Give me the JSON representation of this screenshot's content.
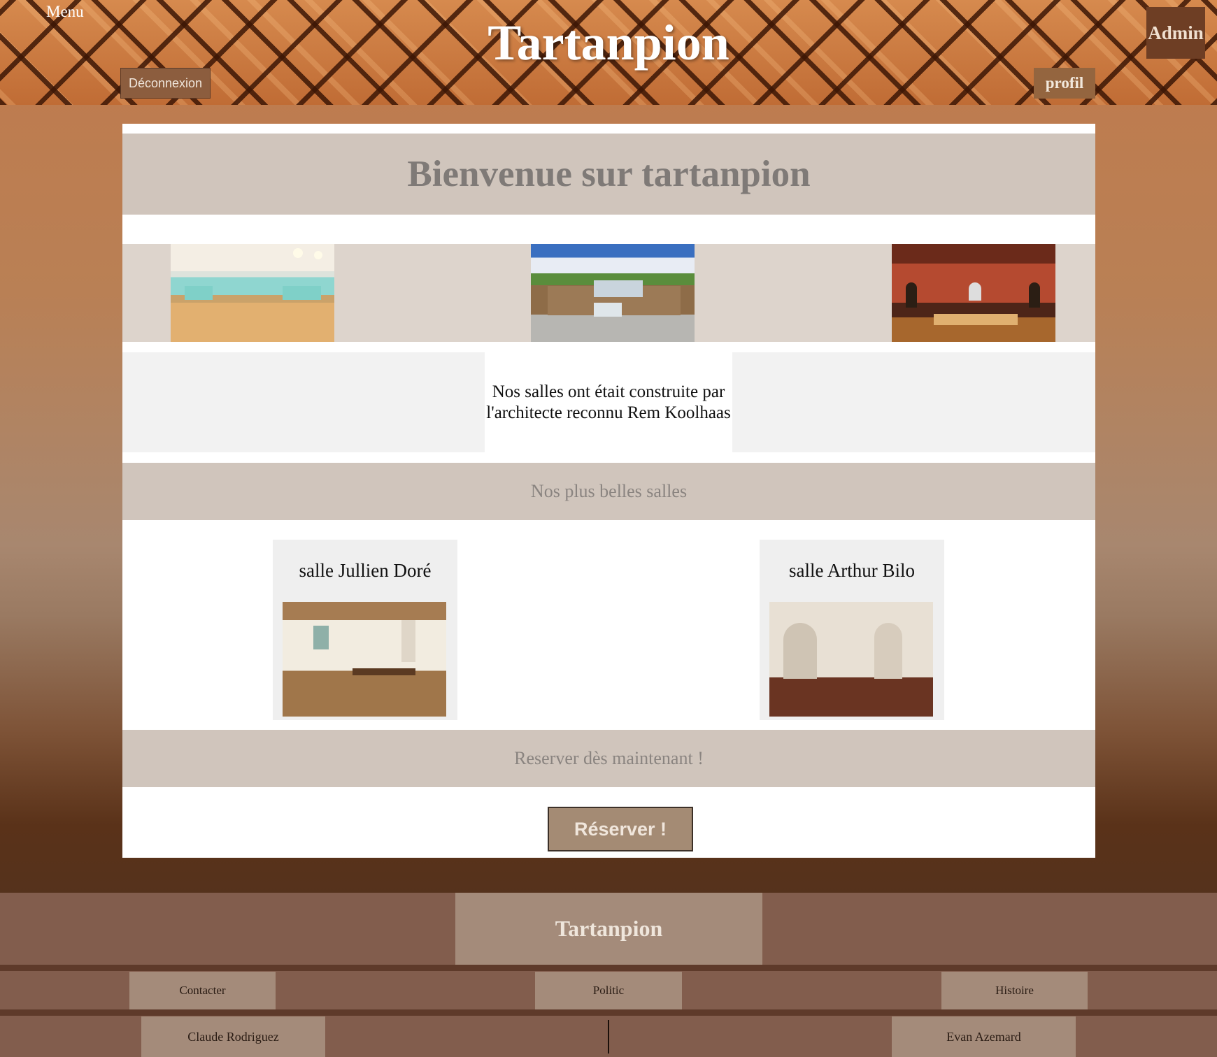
{
  "header": {
    "menu_label": "Menu",
    "site_title": "Tartanpion",
    "logout_label": "Déconnexion",
    "admin_label": "Admin",
    "profil_label": "profil"
  },
  "main": {
    "welcome_title": "Bienvenue sur tartanpion",
    "info_text": "Nos salles ont était construite par l'architecte reconnu Rem Koolhaas",
    "section_salles_title": "Nos plus belles salles",
    "rooms": [
      {
        "name": "salle Jullien Doré"
      },
      {
        "name": "salle Arthur Bilo"
      }
    ],
    "section_reserve_title": "Reserver dès maintenant !",
    "reserve_button_label": "Réserver !"
  },
  "footer": {
    "title": "Tartanpion",
    "links": [
      {
        "label": "Contacter"
      },
      {
        "label": "Politic"
      },
      {
        "label": "Histoire"
      }
    ],
    "authors": [
      {
        "name": "Claude Rodriguez"
      },
      {
        "name": "Evan Azemard"
      }
    ]
  },
  "colors": {
    "header_wood": "#c8773f",
    "band_beige": "#d0c5bc",
    "button_taupe": "#a48b74",
    "footer_brown": "#825d4d"
  }
}
